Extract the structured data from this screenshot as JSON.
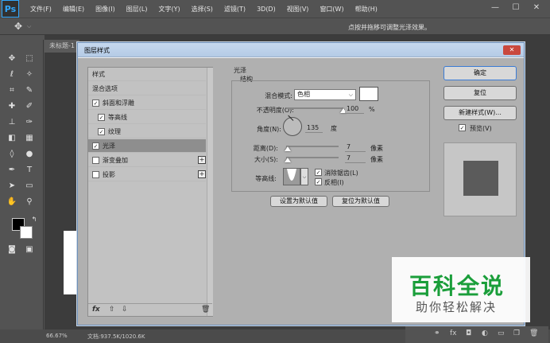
{
  "app": {
    "logo": "Ps",
    "menu": [
      "文件(F)",
      "编辑(E)",
      "图像(I)",
      "图层(L)",
      "文字(Y)",
      "选择(S)",
      "滤镜(T)",
      "3D(D)",
      "视图(V)",
      "窗口(W)",
      "帮助(H)"
    ],
    "window_controls": {
      "minimize": "—",
      "restore": "☐",
      "close": "✕"
    },
    "option_hint": "点按并拖移可调整光泽效果。",
    "doc_tab": "未标题-1",
    "status_zoom": "66.67%",
    "status_doc": "文档:937.5K/1020.6K"
  },
  "dialog": {
    "title": "图层样式",
    "close": "✕",
    "styles_list": [
      {
        "label": "样式",
        "checkbox": false,
        "checked": false,
        "indent": false,
        "selected": false,
        "plus": false
      },
      {
        "label": "混合选项",
        "checkbox": false,
        "checked": false,
        "indent": false,
        "selected": false,
        "plus": false
      },
      {
        "label": "斜面和浮雕",
        "checkbox": true,
        "checked": true,
        "indent": false,
        "selected": false,
        "plus": false
      },
      {
        "label": "等高线",
        "checkbox": true,
        "checked": true,
        "indent": true,
        "selected": false,
        "plus": false
      },
      {
        "label": "纹理",
        "checkbox": true,
        "checked": true,
        "indent": true,
        "selected": false,
        "plus": false
      },
      {
        "label": "光泽",
        "checkbox": true,
        "checked": true,
        "indent": false,
        "selected": true,
        "plus": false
      },
      {
        "label": "渐变叠加",
        "checkbox": true,
        "checked": false,
        "indent": false,
        "selected": false,
        "plus": true
      },
      {
        "label": "投影",
        "checkbox": true,
        "checked": false,
        "indent": false,
        "selected": false,
        "plus": true
      }
    ],
    "bottom_icons": {
      "fx": "fx",
      "up": "⇧",
      "down": "⇩",
      "trash": "🗑"
    },
    "satin": {
      "section": "光泽",
      "group": "结构",
      "blend_mode_label": "混合模式:",
      "blend_mode_value": "色相",
      "opacity_label": "不透明度(O):",
      "opacity_value": "100",
      "opacity_unit": "%",
      "opacity_level": 1.0,
      "angle_label": "角度(N):",
      "angle_value": "135",
      "angle_unit": "度",
      "distance_label": "距离(D):",
      "distance_value": "7",
      "distance_unit": "像素",
      "distance_level": 0.03,
      "size_label": "大小(S):",
      "size_value": "7",
      "size_unit": "像素",
      "size_level": 0.03,
      "contour_label": "等高线:",
      "antialias_label": "消除锯齿(L)",
      "antialias_checked": true,
      "invert_label": "反相(I)",
      "invert_checked": true,
      "btn_set_default": "设置为默认值",
      "btn_reset_default": "复位为默认值"
    },
    "buttons": {
      "ok": "确定",
      "reset": "复位",
      "new_style": "新建样式(W)...",
      "preview_label": "预览(V)",
      "preview_checked": true
    }
  },
  "watermark": {
    "title": "百科全说",
    "subtitle": "助你轻松解决"
  }
}
